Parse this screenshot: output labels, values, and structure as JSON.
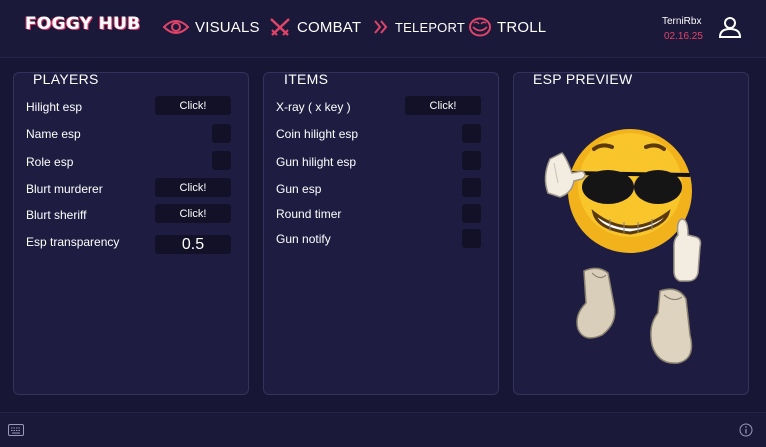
{
  "brand": "FOGGY HUB",
  "nav": {
    "visuals": "VISUALS",
    "combat": "COMBAT",
    "teleport": "TELEPORT",
    "troll": "TROLL"
  },
  "user": {
    "name": "TerniRbx",
    "date": "02.16.25"
  },
  "players": {
    "title": "PLAYERS",
    "rows": [
      {
        "label": "Hilight esp",
        "control": "button",
        "button_label": "Click!"
      },
      {
        "label": "Name esp",
        "control": "toggle"
      },
      {
        "label": "Role esp",
        "control": "toggle"
      },
      {
        "label": "Blurt murderer",
        "control": "button",
        "button_label": "Click!"
      },
      {
        "label": "Blurt sheriff",
        "control": "button",
        "button_label": "Click!"
      },
      {
        "label": "Esp transparency",
        "control": "value",
        "value": "0.5"
      }
    ]
  },
  "items": {
    "title": "ITEMS",
    "rows": [
      {
        "label": "X-ray ( x key )",
        "control": "button",
        "button_label": "Click!"
      },
      {
        "label": "Coin hilight esp",
        "control": "toggle"
      },
      {
        "label": "Gun hilight esp",
        "control": "toggle"
      },
      {
        "label": "Gun esp",
        "control": "toggle"
      },
      {
        "label": "Round timer",
        "control": "toggle"
      },
      {
        "label": "Gun notify",
        "control": "toggle"
      }
    ]
  },
  "preview": {
    "title": "ESP PREVIEW"
  },
  "colors": {
    "background": "#171634",
    "panel": "#1e1d41",
    "control": "#121127",
    "accent": "#e04469"
  },
  "icons": {
    "visuals": "eye-icon",
    "combat": "crossed-swords-icon",
    "teleport": "double-chevron-icon",
    "troll": "trollface-icon",
    "user": "user-icon",
    "keyboard": "keyboard-icon",
    "info": "info-icon"
  }
}
